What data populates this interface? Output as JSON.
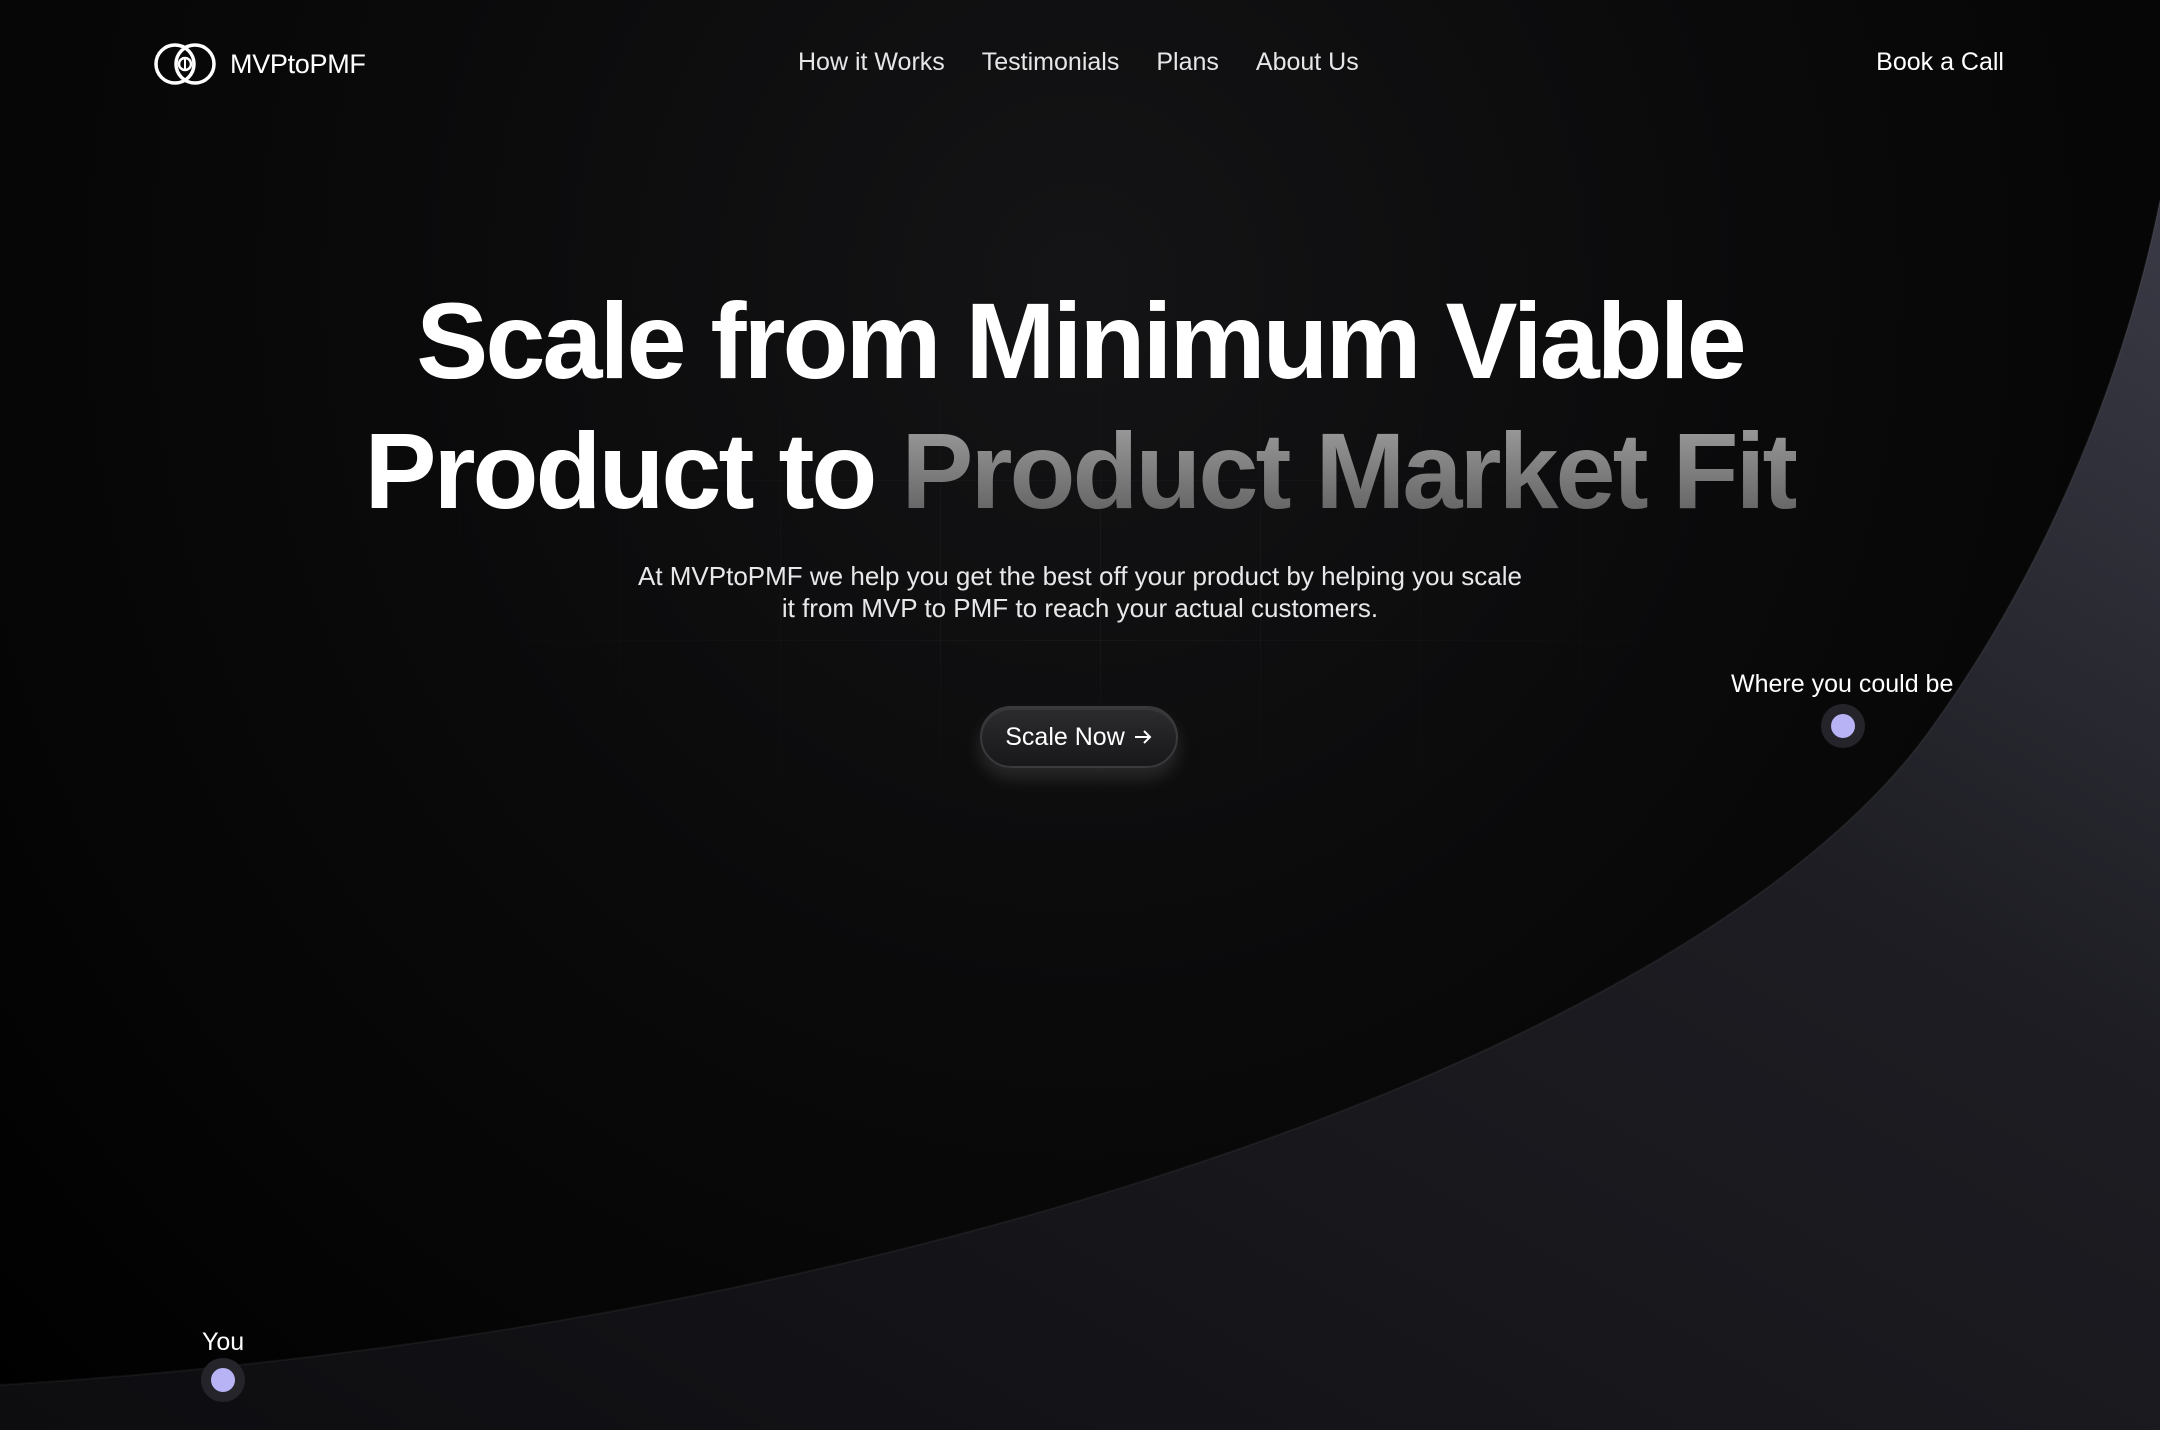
{
  "brand": {
    "name": "MVPtoPMF",
    "logo_icon": "interlocked-rings-logo-icon"
  },
  "nav": {
    "links": [
      "How it Works",
      "Testimonials",
      "Plans",
      "About Us"
    ],
    "cta_label": "Book a Call"
  },
  "hero": {
    "title_line1": "Scale from  Minimum Viable",
    "title_line2_plain": "Product to ",
    "title_line2_faded": "Product Market Fit",
    "subtitle_line1": "At MVPtoPMF we help you get the best off your product by helping you scale",
    "subtitle_line2": "it from MVP to PMF to reach your actual customers.",
    "cta_label": "Scale Now",
    "cta_icon": "arrow-right-icon"
  },
  "markers": {
    "start_label": "You",
    "end_label": "Where you could be"
  },
  "colors": {
    "background": "#000000",
    "curve_fill": "#1c1c22",
    "dot_accent": "#b8b3f5",
    "faded_text": "#8a8a8a"
  }
}
